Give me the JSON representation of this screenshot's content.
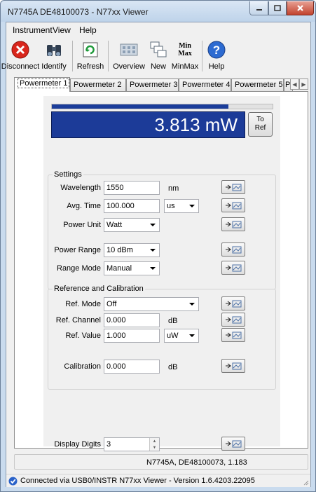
{
  "window": {
    "title": "N7745A DE48100073 - N77xx Viewer"
  },
  "menu": {
    "instrument": "Instrument",
    "view": "View",
    "help": "Help"
  },
  "toolbar": {
    "disconnect": "Disconnect",
    "identify": "Identify",
    "refresh": "Refresh",
    "overview": "Overview",
    "new": "New",
    "minmax": "MinMax",
    "help": "Help",
    "minmax_icon_top": "Min",
    "minmax_icon_bottom": "Max"
  },
  "tabs": [
    "Powermeter 1",
    "Powermeter 2",
    "Powermeter 3",
    "Powermeter 4",
    "Powermeter 5",
    "P"
  ],
  "active_tab": "Powermeter 1",
  "readout": {
    "value": "3.813 mW",
    "progress_percent": 80,
    "to_ref_line1": "To",
    "to_ref_line2": "Ref"
  },
  "settings": {
    "legend": "Settings",
    "wavelength_label": "Wavelength",
    "wavelength_value": "1550",
    "wavelength_unit": "nm",
    "avg_time_label": "Avg. Time",
    "avg_time_value": "100.000",
    "avg_time_unit": "us",
    "power_unit_label": "Power Unit",
    "power_unit_value": "Watt",
    "power_range_label": "Power Range",
    "power_range_value": "10 dBm",
    "range_mode_label": "Range Mode",
    "range_mode_value": "Manual"
  },
  "reference": {
    "legend": "Reference and Calibration",
    "ref_mode_label": "Ref. Mode",
    "ref_mode_value": "Off",
    "ref_channel_label": "Ref. Channel",
    "ref_channel_value": "0.000",
    "ref_channel_unit": "dB",
    "ref_value_label": "Ref. Value",
    "ref_value_value": "1.000",
    "ref_value_unit": "uW",
    "calibration_label": "Calibration",
    "calibration_value": "0.000",
    "calibration_unit": "dB"
  },
  "display": {
    "digits_label": "Display Digits",
    "digits_value": "3"
  },
  "status_box": "N7745A, DE48100073, 1.183",
  "status_bar": "Connected via USB0/INSTR  N77xx Viewer - Version 1.6.4203.22095",
  "colors": {
    "readout_bg": "#1c3b98",
    "progress_fill": "#1b3d9a",
    "disconnect_red": "#d9261c",
    "status_ok": "#2a62c9"
  }
}
